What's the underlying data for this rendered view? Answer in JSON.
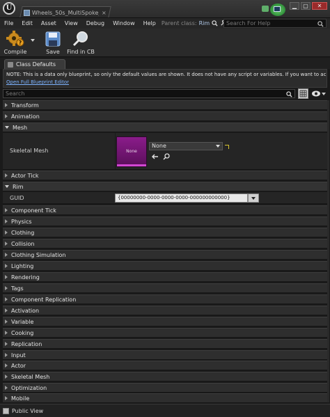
{
  "window": {
    "tab_title": "Wheels_50s_MultiSpoke_0",
    "tab_close": "×",
    "minimize": "▁",
    "maximize": "▢",
    "close": "✕"
  },
  "menu": {
    "items": [
      "File",
      "Edit",
      "Asset",
      "View",
      "Debug",
      "Window",
      "Help"
    ],
    "parent_class_label": "Parent class:",
    "parent_class_value": "Rim",
    "search_placeholder": "Search For Help"
  },
  "toolbar": {
    "compile": "Compile",
    "save": "Save",
    "find_in_cb": "Find in CB"
  },
  "panel": {
    "tab_label": "Class Defaults",
    "note": "NOTE: This is a data only blueprint, so only the default values are shown.  It does not have any script or variables.  If you want to ac",
    "note_link": "Open Full Blueprint Editor",
    "search_placeholder": "Search"
  },
  "categories_top": [
    {
      "label": "Transform",
      "expanded": false
    },
    {
      "label": "Animation",
      "expanded": false
    },
    {
      "label": "Mesh",
      "expanded": true
    }
  ],
  "mesh": {
    "skeletal_mesh_label": "Skeletal Mesh",
    "thumbnail_text": "None",
    "combo_value": "None"
  },
  "actor_tick": "Actor Tick",
  "rim": {
    "label": "Rim",
    "guid_label": "GUID",
    "guid_value": "{00000000-0000-0000-0000-000000000000}"
  },
  "categories_bottom": [
    "Component Tick",
    "Physics",
    "Clothing",
    "Collision",
    "Clothing Simulation",
    "Lighting",
    "Rendering",
    "Tags",
    "Component Replication",
    "Activation",
    "Variable",
    "Cooking",
    "Replication",
    "Input",
    "Actor",
    "Skeletal Mesh",
    "Optimization",
    "Mobile"
  ],
  "footer": {
    "public_view": "Public View"
  },
  "colors": {
    "accent_link": "#7db3ff",
    "thumbnail": "#8a1c8a",
    "thumbnail_bar": "#d247d2"
  }
}
